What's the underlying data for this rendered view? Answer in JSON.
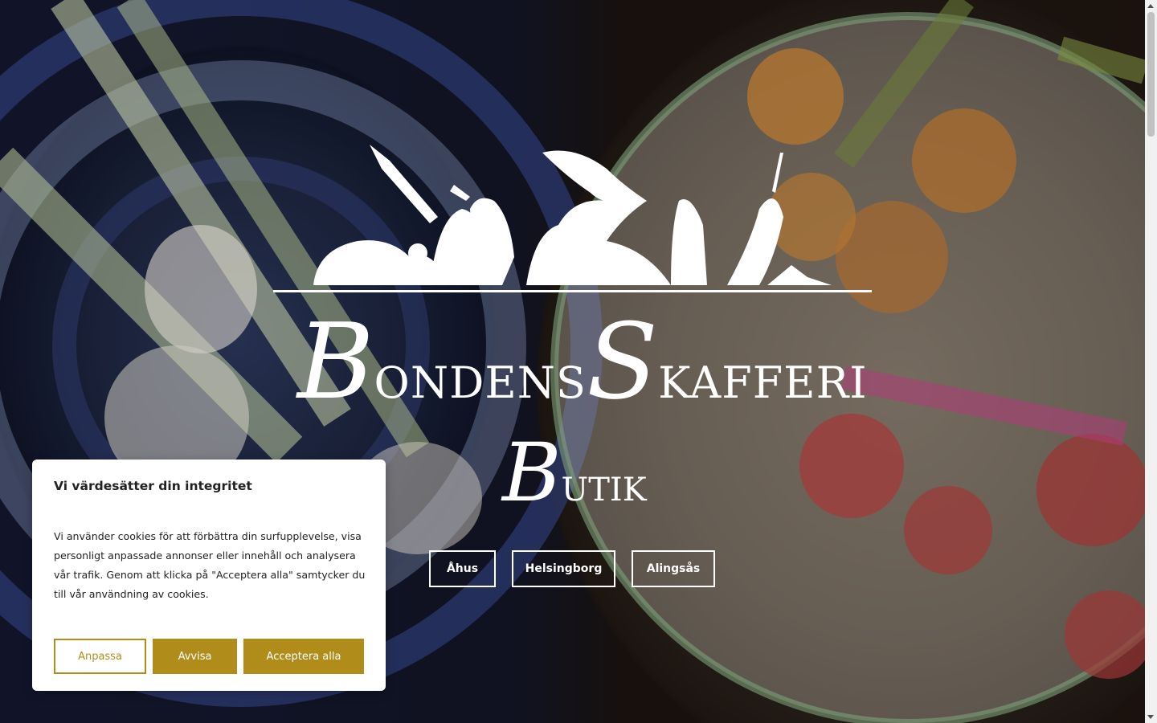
{
  "brand": {
    "name_initial_1": "B",
    "name_rest_1": "ONDENS",
    "name_initial_2": "S",
    "name_rest_2": "KAFFERI",
    "sub_initial": "B",
    "sub_rest": "UTIK"
  },
  "locations": [
    {
      "label": "Åhus"
    },
    {
      "label": "Helsingborg"
    },
    {
      "label": "Alingsås"
    }
  ],
  "cookie_banner": {
    "title": "Vi värdesätter din integritet",
    "text": "Vi använder cookies för att förbättra din surfupplevelse, visa personligt anpassade annonser eller innehåll och analysera vår trafik. Genom att klicka på \"Acceptera alla\" samtycker du till vår användning av cookies.",
    "customize_label": "Anpassa",
    "reject_label": "Avvisa",
    "accept_label": "Acceptera alla"
  },
  "colors": {
    "accent": "#b08d1a",
    "hero_text": "#ffffff"
  },
  "icons": {
    "logo": "vegetables-illustration-icon"
  }
}
